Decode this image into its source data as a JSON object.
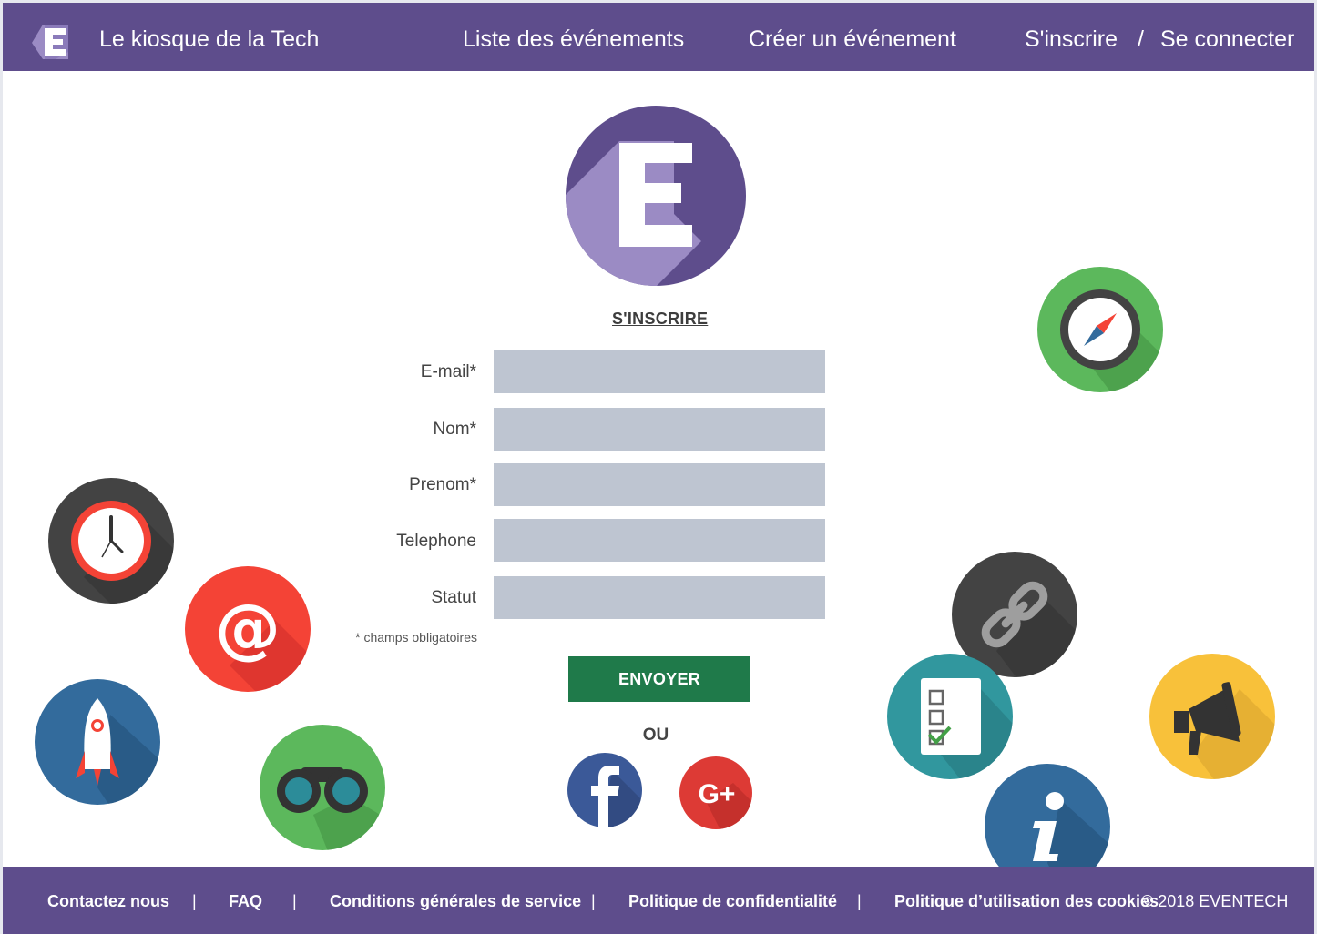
{
  "header": {
    "brand_name": "Le kiosque de la Tech",
    "brand_letter": "E",
    "nav": {
      "events_list": "Liste des événements",
      "create_event": "Créer un événement",
      "signup": "S'inscrire",
      "separator": "/",
      "login": "Se connecter"
    }
  },
  "form": {
    "title": "S'INSCRIRE",
    "fields": [
      {
        "label": "E-mail*",
        "value": ""
      },
      {
        "label": "Nom*",
        "value": ""
      },
      {
        "label": "Prenom*",
        "value": ""
      },
      {
        "label": "Telephone",
        "value": ""
      },
      {
        "label": "Statut",
        "value": ""
      }
    ],
    "required_note": "* champs obligatoires",
    "submit_label": "ENVOYER",
    "or_label": "OU"
  },
  "social": {
    "facebook_icon": "facebook-icon",
    "google_icon": "google-plus-icon",
    "google_text": "G+"
  },
  "decorations": [
    "clock-icon",
    "at-sign-icon",
    "rocket-icon",
    "binoculars-icon",
    "compass-icon",
    "link-icon",
    "checklist-icon",
    "megaphone-icon",
    "info-icon"
  ],
  "footer": {
    "links": [
      "Contactez nous",
      "FAQ",
      "Conditions générales de service",
      "Politique de confidentialité",
      "Politique d’utilisation des cookies"
    ],
    "separator": "|",
    "copyright": "© 2018 EVENTECH"
  },
  "colors": {
    "brand": "#5e4d8c",
    "brand_light": "#9b8bc4",
    "input_bg": "#bec5d1",
    "submit": "#1f7a4a"
  }
}
